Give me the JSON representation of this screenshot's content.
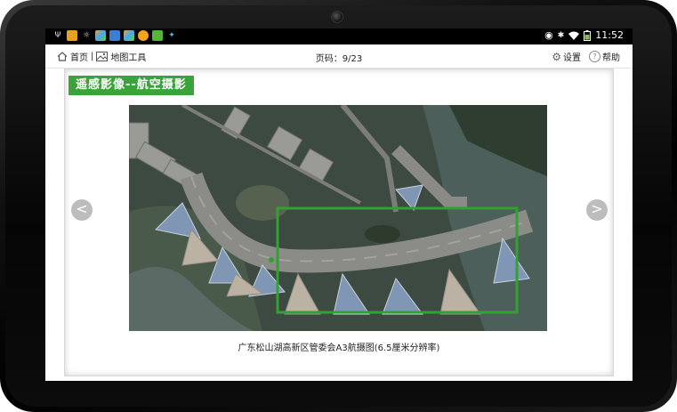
{
  "statusbar": {
    "time": "11:52",
    "left_icons": [
      "usb-icon",
      "app-icon",
      "brightness-icon",
      "app-icon",
      "app-icon",
      "app-icon",
      "weather-icon",
      "app-icon",
      "app-icon"
    ],
    "right_icons": [
      "eye-icon",
      "nfc-icon",
      "wifi-icon",
      "battery-icon"
    ]
  },
  "navbar": {
    "home_label": "首页",
    "separator": "|",
    "map_tools_label": "地图工具",
    "page_indicator": "页码：9/23",
    "settings_label": "设置",
    "help_label": "帮助"
  },
  "content": {
    "title": "遥感影像--航空摄影",
    "caption": "广东松山湖高新区管委会A3航摄图(6.5厘米分辨率)",
    "prev_glyph": "<",
    "next_glyph": ">"
  },
  "colors": {
    "accent_green": "#3aa33a",
    "highlight_box": "#33a033",
    "arrow_bg": "#bdbdbd"
  }
}
